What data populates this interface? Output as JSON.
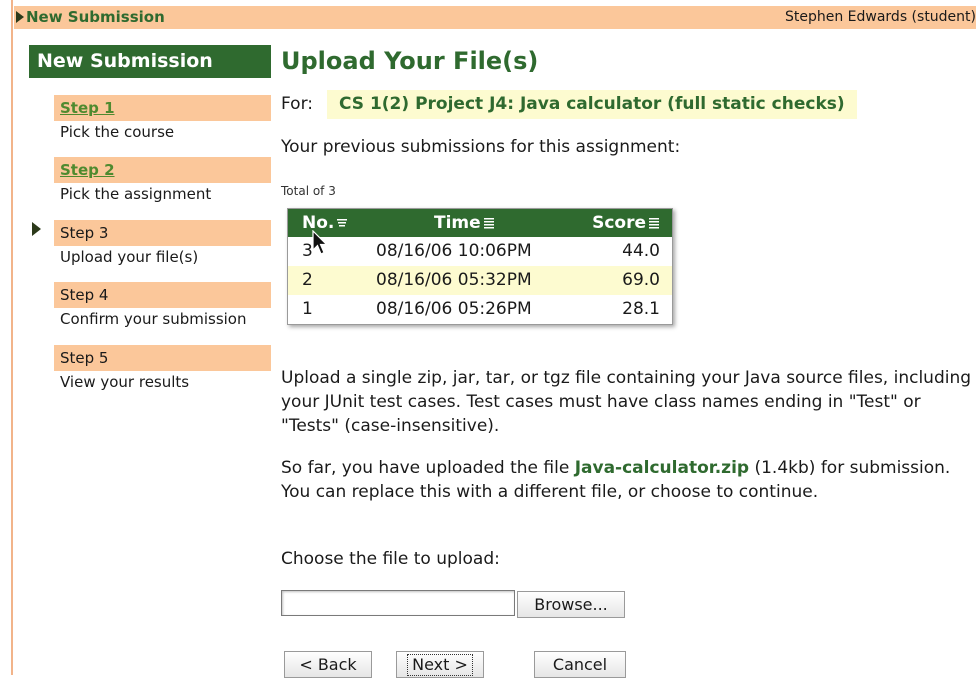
{
  "topbar": {
    "title": "New Submission",
    "user": "Stephen Edwards (student)"
  },
  "sidebar": {
    "heading": "New Submission",
    "steps": [
      {
        "label": "Step 1",
        "desc": "Pick the course",
        "link": true
      },
      {
        "label": "Step 2",
        "desc": "Pick the assignment",
        "link": true
      },
      {
        "label": "Step 3",
        "desc": "Upload your file(s)",
        "link": false,
        "current": true
      },
      {
        "label": "Step 4",
        "desc": "Confirm your submission",
        "link": false
      },
      {
        "label": "Step 5",
        "desc": "View your results",
        "link": false
      }
    ]
  },
  "main": {
    "title": "Upload Your File(s)",
    "for_label": "For:",
    "for_value": "CS 1(2) Project J4: Java calculator (full static checks)",
    "previous_text": "Your previous submissions for this assignment:",
    "total": "Total of 3",
    "table": {
      "headers": [
        "No.",
        "Time",
        "Score"
      ],
      "rows": [
        [
          "3",
          "08/16/06 10:06PM",
          "44.0"
        ],
        [
          "2",
          "08/16/06 05:32PM",
          "69.0"
        ],
        [
          "1",
          "08/16/06 05:26PM",
          "28.1"
        ]
      ]
    },
    "instructions": "Upload a single zip, jar, tar, or tgz file containing your Java source files, including your JUnit test cases. Test cases must have class names ending in \"Test\" or \"Tests\" (case-insensitive).",
    "uploaded_pre": "So far, you have uploaded the file ",
    "uploaded_file": "Java-calculator.zip",
    "uploaded_post": " (1.4kb) for submission. You can replace this with a different file, or choose to continue.",
    "choose_label": "Choose the file to upload:",
    "file_value": "",
    "browse_label": "Browse...",
    "back_label": "< Back",
    "next_label": "Next >",
    "cancel_label": "Cancel"
  },
  "colors": {
    "accent": "#2f6a2f",
    "peach": "#fbc79a",
    "highlight": "#fdfbd0"
  }
}
